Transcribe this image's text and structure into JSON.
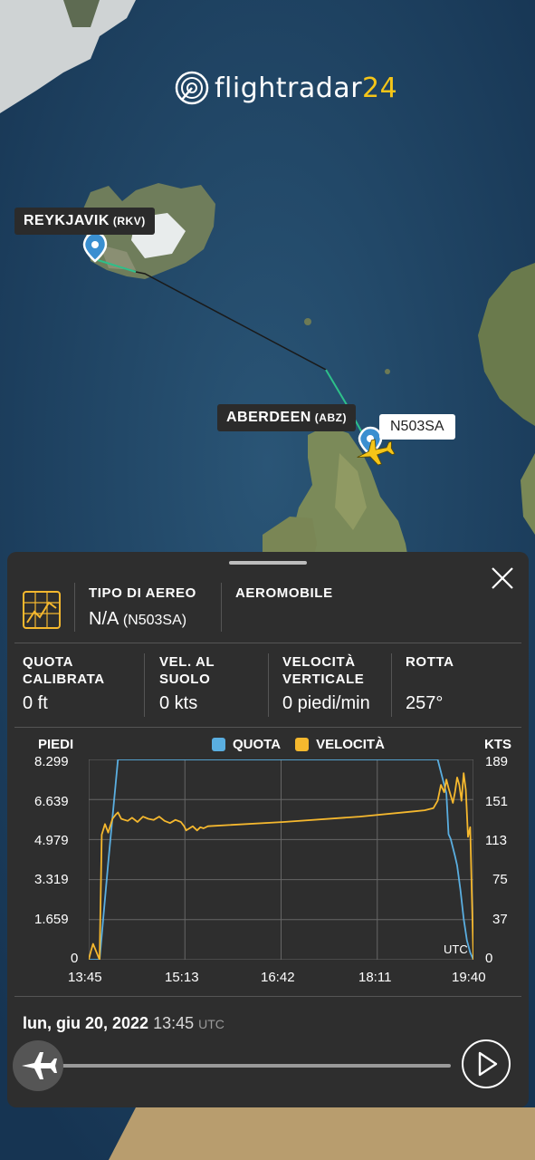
{
  "logo": {
    "text_main": "flightradar",
    "text_num": "24"
  },
  "map": {
    "origin": {
      "name": "REYKJAVIK",
      "code": "(RKV)"
    },
    "destination": {
      "name": "ABERDEEN",
      "code": "(ABZ)"
    },
    "callsign": "N503SA"
  },
  "panel": {
    "aircraft_type": {
      "label": "TIPO DI AEREO",
      "value": "N/A",
      "sub": "(N503SA)"
    },
    "aircraft": {
      "label": "AEROMOBILE"
    },
    "stats": [
      {
        "label_line1": "QUOTA",
        "label_line2": "CALIBRATA",
        "value": "0 ft"
      },
      {
        "label_line1": "VEL. AL",
        "label_line2": "SUOLO",
        "value": "0 kts"
      },
      {
        "label_line1": "VELOCITÀ",
        "label_line2": "VERTICALE",
        "value": "0 piedi/min"
      },
      {
        "label_line1": "ROTTA",
        "label_line2": "",
        "value": "257°"
      }
    ],
    "date": {
      "day": "lun, giu 20, 2022",
      "time": "13:45",
      "tz": "UTC"
    }
  },
  "chart_data": {
    "type": "line",
    "left_axis_title": "PIEDI",
    "right_axis_title": "KTS",
    "utc_label": "UTC",
    "left_ticks": [
      "8.299",
      "6.639",
      "4.979",
      "3.319",
      "1.659",
      "0"
    ],
    "right_ticks": [
      "189",
      "151",
      "113",
      "75",
      "37",
      "0"
    ],
    "x_ticks": [
      "13:45",
      "15:13",
      "16:42",
      "18:11",
      "19:40"
    ],
    "xlim": [
      0,
      355
    ],
    "ylim_left": [
      0,
      8299
    ],
    "ylim_right": [
      0,
      189
    ],
    "series": [
      {
        "name": "QUOTA",
        "color": "#5aaee0",
        "axis": "left",
        "x": [
          0,
          10,
          18,
          27,
          322,
          330,
          332,
          334,
          338,
          340,
          343,
          346,
          349,
          352,
          355
        ],
        "y": [
          0,
          0,
          4000,
          8299,
          8299,
          6900,
          5200,
          5000,
          4300,
          3900,
          2900,
          1700,
          800,
          300,
          0
        ]
      },
      {
        "name": "VELOCITÀ",
        "color": "#f5b82e",
        "axis": "right",
        "x": [
          0,
          2,
          4,
          6,
          8,
          10,
          12,
          15,
          18,
          22,
          25,
          27,
          30,
          33,
          36,
          40,
          45,
          50,
          55,
          60,
          65,
          70,
          75,
          80,
          85,
          88,
          90,
          93,
          96,
          100,
          103,
          106,
          110,
          180,
          250,
          300,
          310,
          318,
          322,
          325,
          328,
          330,
          332,
          336,
          338,
          340,
          342,
          344,
          346,
          348,
          350,
          352,
          355
        ],
        "y": [
          0,
          8,
          15,
          10,
          5,
          0,
          118,
          128,
          120,
          133,
          137,
          139,
          133,
          132,
          131,
          134,
          130,
          135,
          133,
          132,
          135,
          131,
          129,
          132,
          130,
          126,
          122,
          124,
          126,
          122,
          125,
          124,
          126,
          130,
          135,
          140,
          141,
          143,
          150,
          165,
          158,
          170,
          162,
          148,
          158,
          172,
          165,
          150,
          176,
          160,
          116,
          125,
          0
        ]
      }
    ]
  }
}
